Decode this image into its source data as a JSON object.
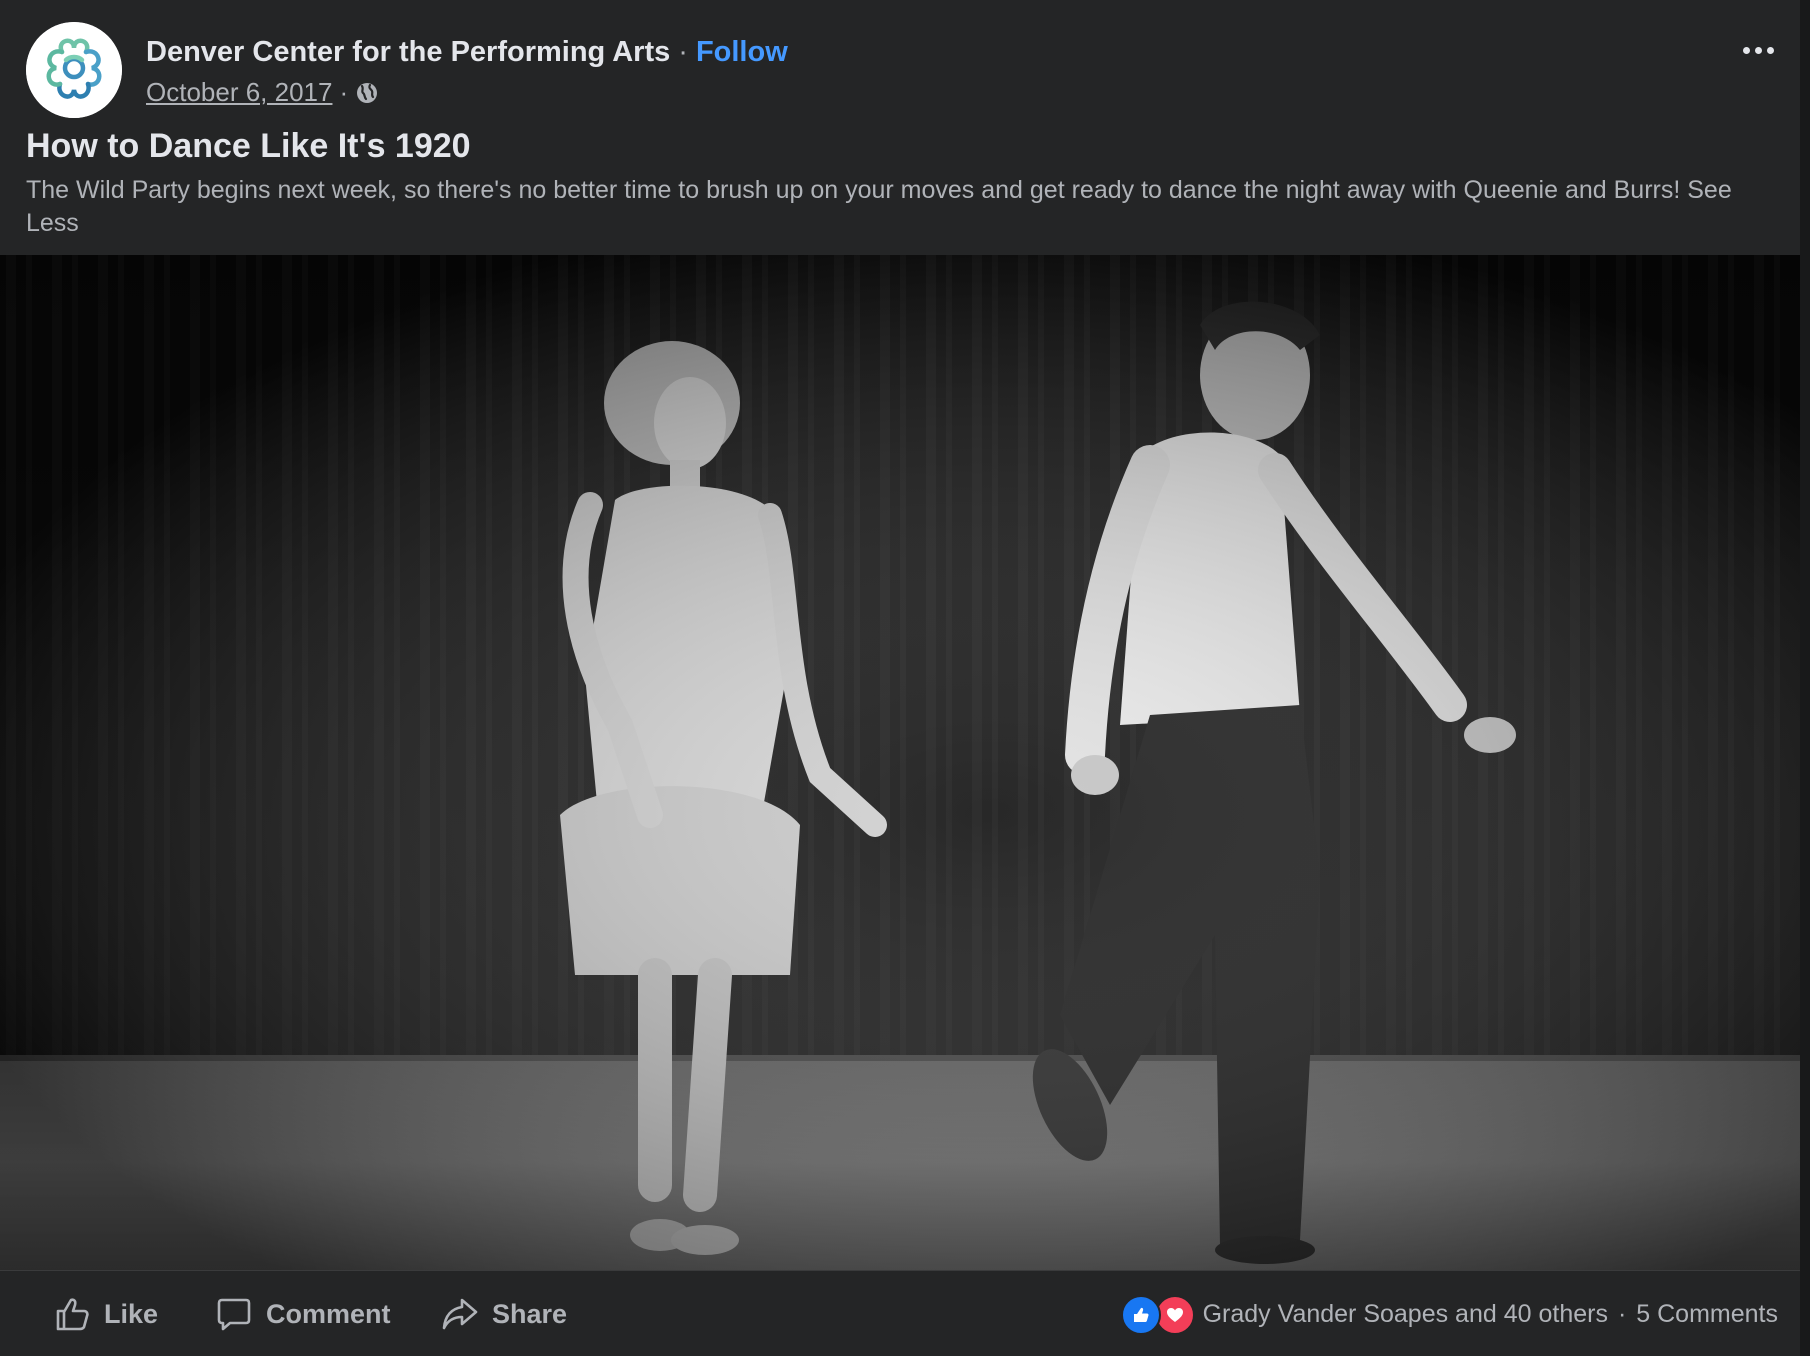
{
  "post": {
    "page_name": "Denver Center for the Performing Arts",
    "separator": "·",
    "follow_label": "Follow",
    "date": "October 6, 2017",
    "meta_separator": "·",
    "privacy_icon": "globe-icon",
    "more_icon": "more-options-icon",
    "title": "How to Dance Like It's 1920",
    "text": "The Wild Party begins next week, so there's no better time to brush up on your moves and get ready to dance the night away with Queenie and Burrs!",
    "see_less_label": "See Less"
  },
  "video": {
    "kind": "black-and-white dance video still"
  },
  "footer": {
    "actions": [
      {
        "label": "Like",
        "icon": "thumbs-up-icon"
      },
      {
        "label": "Comment",
        "icon": "comment-bubble-icon"
      },
      {
        "label": "Share",
        "icon": "share-arrow-icon"
      }
    ],
    "reaction_icons": [
      "like-reaction-icon",
      "love-reaction-icon"
    ],
    "reactors": "Grady Vander Soapes and 40 others",
    "separator": "·",
    "comments": "5 Comments"
  },
  "colors": {
    "background": "#242526",
    "primary_text": "#e4e6eb",
    "secondary_text": "#b0b3b8",
    "link": "#4599ff",
    "like_blue": "#1877f2",
    "love_red": "#f33e58"
  }
}
